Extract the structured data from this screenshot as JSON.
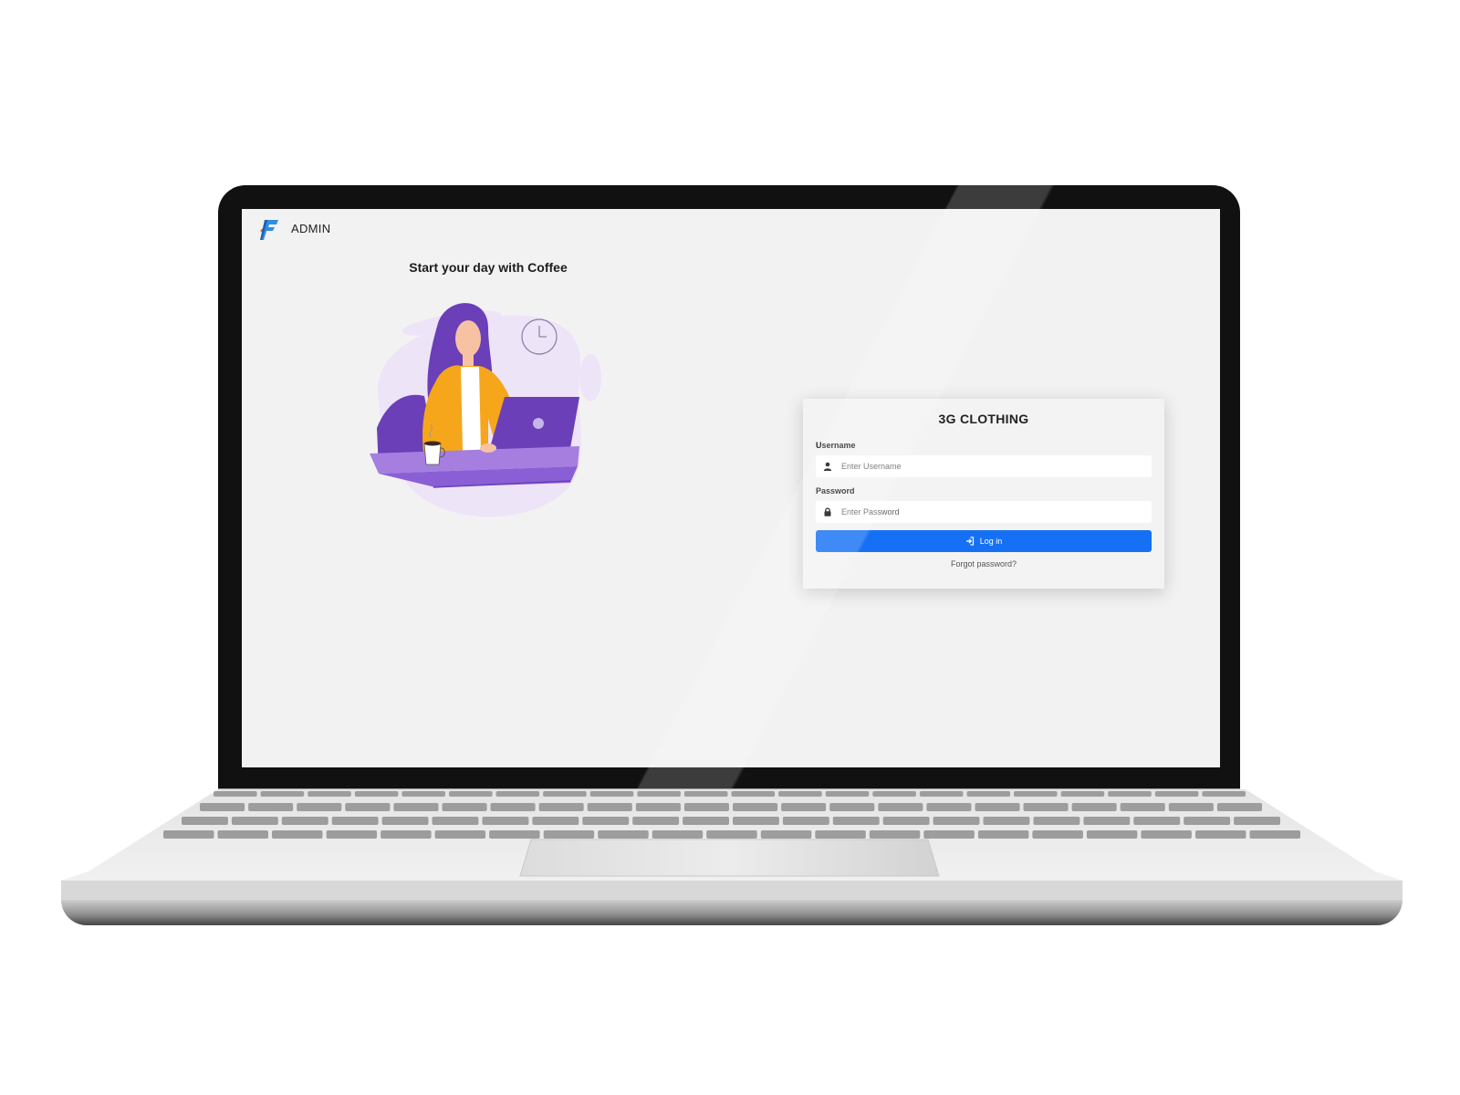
{
  "header": {
    "brand_label": "ADMIN"
  },
  "hero": {
    "title": "Start your day with Coffee"
  },
  "login": {
    "title": "3G CLOTHING",
    "username_label": "Username",
    "username_placeholder": "Enter Username",
    "password_label": "Password",
    "password_placeholder": "Enter Password",
    "login_button": "Log in",
    "forgot_link": "Forgot password?"
  },
  "icons": {
    "brand": "brand-logo-icon",
    "username": "user-icon",
    "password": "lock-icon",
    "login": "sign-in-icon"
  },
  "colors": {
    "primary": "#1670f4",
    "page_background": "#f2f2f2",
    "illustration_purple": "#6a3fb8",
    "illustration_orange": "#f5a61b"
  }
}
